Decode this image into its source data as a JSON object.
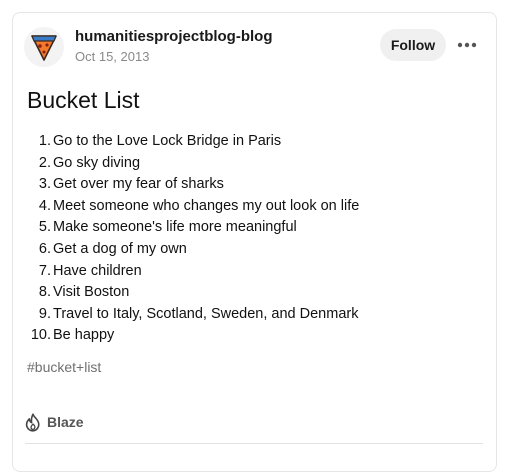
{
  "post": {
    "blog_name": "humanitiesprojectblog-blog",
    "date": "Oct 15, 2013",
    "follow_label": "Follow",
    "title": "Bucket List",
    "items": [
      {
        "num": "1.",
        "text": "Go to the Love Lock Bridge in Paris"
      },
      {
        "num": "2.",
        "text": "Go sky diving"
      },
      {
        "num": "3.",
        "text": "Get over my fear of sharks"
      },
      {
        "num": "4.",
        "text": "Meet someone who changes my out look on life"
      },
      {
        "num": "5.",
        "text": "Make someone's life more meaningful"
      },
      {
        "num": "6.",
        "text": "Get a dog of my own"
      },
      {
        "num": "7.",
        "text": "Have children"
      },
      {
        "num": "8.",
        "text": "Visit Boston"
      },
      {
        "num": "9.",
        "text": "Travel to Italy, Scotland, Sweden, and Denmark"
      },
      {
        "num": "10.",
        "text": "Be happy"
      }
    ],
    "tag": "#bucket+list",
    "blaze_label": "Blaze"
  },
  "icons": {
    "avatar": "pizza-slice-avatar",
    "more": "ellipsis-icon",
    "blaze": "flame-icon"
  },
  "colors": {
    "avatar_orange": "#f47a2b",
    "avatar_blue": "#3a7bc8",
    "follow_bg": "#f0f0f0",
    "muted_text": "#8a8a8a"
  }
}
